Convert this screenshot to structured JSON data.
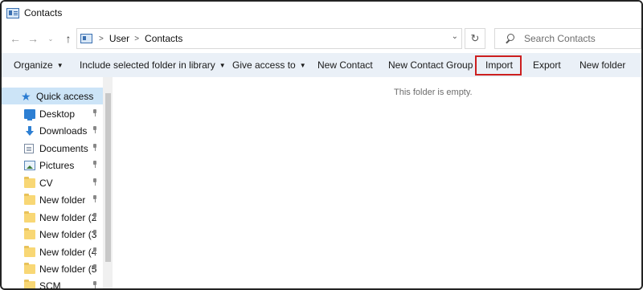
{
  "window": {
    "title": "Contacts"
  },
  "address": {
    "breadcrumbs": [
      "User",
      "Contacts"
    ],
    "search_placeholder": "Search Contacts"
  },
  "toolbar": {
    "organize": "Organize",
    "include_in_library": "Include selected folder in library",
    "give_access": "Give access to",
    "new_contact": "New Contact",
    "new_contact_group": "New Contact Group",
    "import": "Import",
    "export": "Export",
    "new_folder": "New folder"
  },
  "sidebar": {
    "items": [
      {
        "label": "Quick access",
        "icon": "star-icon"
      },
      {
        "label": "Desktop",
        "icon": "desktop-icon"
      },
      {
        "label": "Downloads",
        "icon": "downloads-icon"
      },
      {
        "label": "Documents",
        "icon": "documents-icon"
      },
      {
        "label": "Pictures",
        "icon": "pictures-icon"
      },
      {
        "label": "CV",
        "icon": "folder-icon"
      },
      {
        "label": "New folder",
        "icon": "folder-icon"
      },
      {
        "label": "New folder (2",
        "icon": "folder-icon"
      },
      {
        "label": "New folder (3",
        "icon": "folder-icon"
      },
      {
        "label": "New folder (4",
        "icon": "folder-icon"
      },
      {
        "label": "New folder (5",
        "icon": "folder-icon"
      },
      {
        "label": "SCM",
        "icon": "folder-icon"
      }
    ]
  },
  "content": {
    "empty_message": "This folder is empty."
  },
  "colors": {
    "command_bar_bg": "#eaf0f7",
    "selection_bg": "#cce4f7",
    "highlight_border": "#cc1f1f"
  }
}
